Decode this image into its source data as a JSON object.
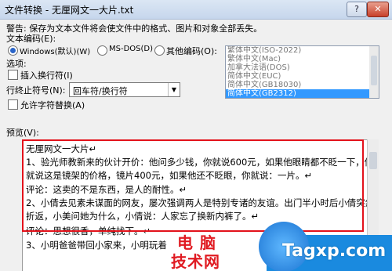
{
  "window": {
    "title": "文件转换 - 无厘网文一大片.txt",
    "help_label": "?",
    "close_label": "✕"
  },
  "warning": "警告: 保存为文本文件将会使文件中的格式、图片和对象全部丢失。",
  "encoding": {
    "label": "文本编码(E):",
    "options": [
      {
        "label": "Windows(默认)(W)",
        "selected": true
      },
      {
        "label": "MS-DOS(D)",
        "selected": false
      },
      {
        "label": "其他编码(O):",
        "selected": false
      }
    ],
    "list_items": [
      "繁体中文(ISO-2022)",
      "繁体中文(Mac)",
      "加拿大法语(DOS)",
      "简体中文(EUC)",
      "简体中文(GB18030)",
      "简体中文(GB2312)"
    ],
    "selected_index": 5
  },
  "options": {
    "label": "选项:",
    "insert_breaks": "插入换行符(I)",
    "line_end_label": "行终止符号(N):",
    "line_end_value": "回车符/换行符",
    "allow_sub": "允许字符替换(A)"
  },
  "preview": {
    "label": "预览(V):",
    "lines": [
      "无厘网文一大片↵",
      "1、验光师教新来的伙计开价：他问多少钱，你就说600元，如果他眼睛都不眨一下，你",
      "就说这是镜架的价格，镜片400元，如果他还不眨眼，你就说：一片。↵",
      "评论：这卖的不是东西，是人的耐性。↵",
      "2、小倩去见素未谋面的网友，屡次强调两人是特别专诸的友谊。出门半小时后小倩突然",
      "折返，小美问她为什么，小倩说：人家忘了换新内裤了。↵",
      "评论：思想很香，单纯找下。↵",
      "3、小明爸爸带回小家来，小明玩着"
    ]
  },
  "watermark": {
    "cn_top": "电 脑",
    "cn_bottom": "技术网",
    "url": "Tagxp.com"
  }
}
